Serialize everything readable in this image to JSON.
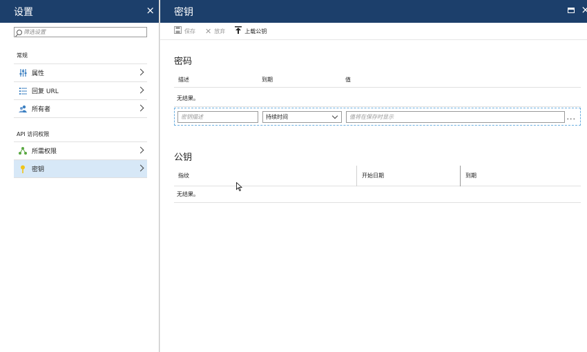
{
  "left_panel": {
    "title": "设置",
    "close_icon": "×",
    "search": {
      "placeholder": "筛选设置"
    },
    "section_general": "常规",
    "general_items": [
      {
        "label": "属性",
        "icon": "properties-icon"
      },
      {
        "label": "回复 URL",
        "icon": "list-icon"
      },
      {
        "label": "所有者",
        "icon": "owners-icon"
      }
    ],
    "section_api": "API 访问权限",
    "api_items": [
      {
        "label": "所需权限",
        "icon": "permissions-icon"
      },
      {
        "label": "密钥",
        "icon": "key-icon",
        "selected": true
      }
    ]
  },
  "right_panel": {
    "title": "密钥",
    "toolbar": {
      "save_label": "保存",
      "discard_label": "放弃",
      "upload_label": "上载公钥"
    },
    "passwords": {
      "title": "密码",
      "columns": [
        "描述",
        "到期",
        "值"
      ],
      "no_result": "无结果。",
      "desc_placeholder": "密钥描述",
      "duration_value": "持续时间",
      "value_placeholder": "值将在保存时显示",
      "more": "..."
    },
    "public_keys": {
      "title": "公钥",
      "columns": [
        "指纹",
        "开始日期",
        "到期"
      ],
      "no_result": "无结果。"
    }
  },
  "colors": {
    "header_bg": "#1c3f6b",
    "selected_bg": "#d7e8f7",
    "accent": "#3a7fc1"
  }
}
